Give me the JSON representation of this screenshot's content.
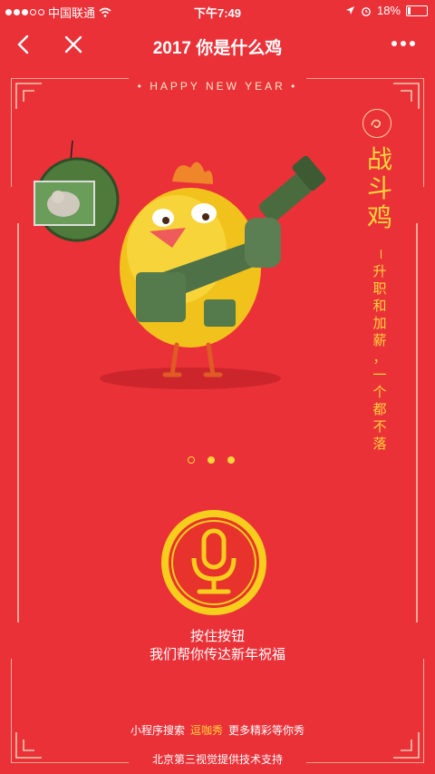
{
  "status": {
    "carrier": "中国联通",
    "time": "下午7:49",
    "battery": "18%",
    "battery_level": 0.18
  },
  "nav": {
    "title": "2017 你是什么鸡"
  },
  "tagline": "• HAPPY NEW YEAR •",
  "badge_glyph": "~",
  "side_title": [
    "战",
    "斗",
    "鸡"
  ],
  "side_sub": [
    "升",
    "职",
    "和",
    "加",
    "薪",
    "，",
    "一",
    "个",
    "都",
    "不",
    "落"
  ],
  "pager_active": 1,
  "hint": {
    "line1": "按住按钮",
    "line2": "我们帮你传达新年祝福"
  },
  "footer": {
    "prefix": "小程序搜索",
    "highlight": "逗咖秀",
    "suffix": "更多精彩等你秀",
    "credit": "北京第三视觉提供技术支持"
  },
  "colors": {
    "background": "#ea3138",
    "accent": "#ffd43b"
  }
}
